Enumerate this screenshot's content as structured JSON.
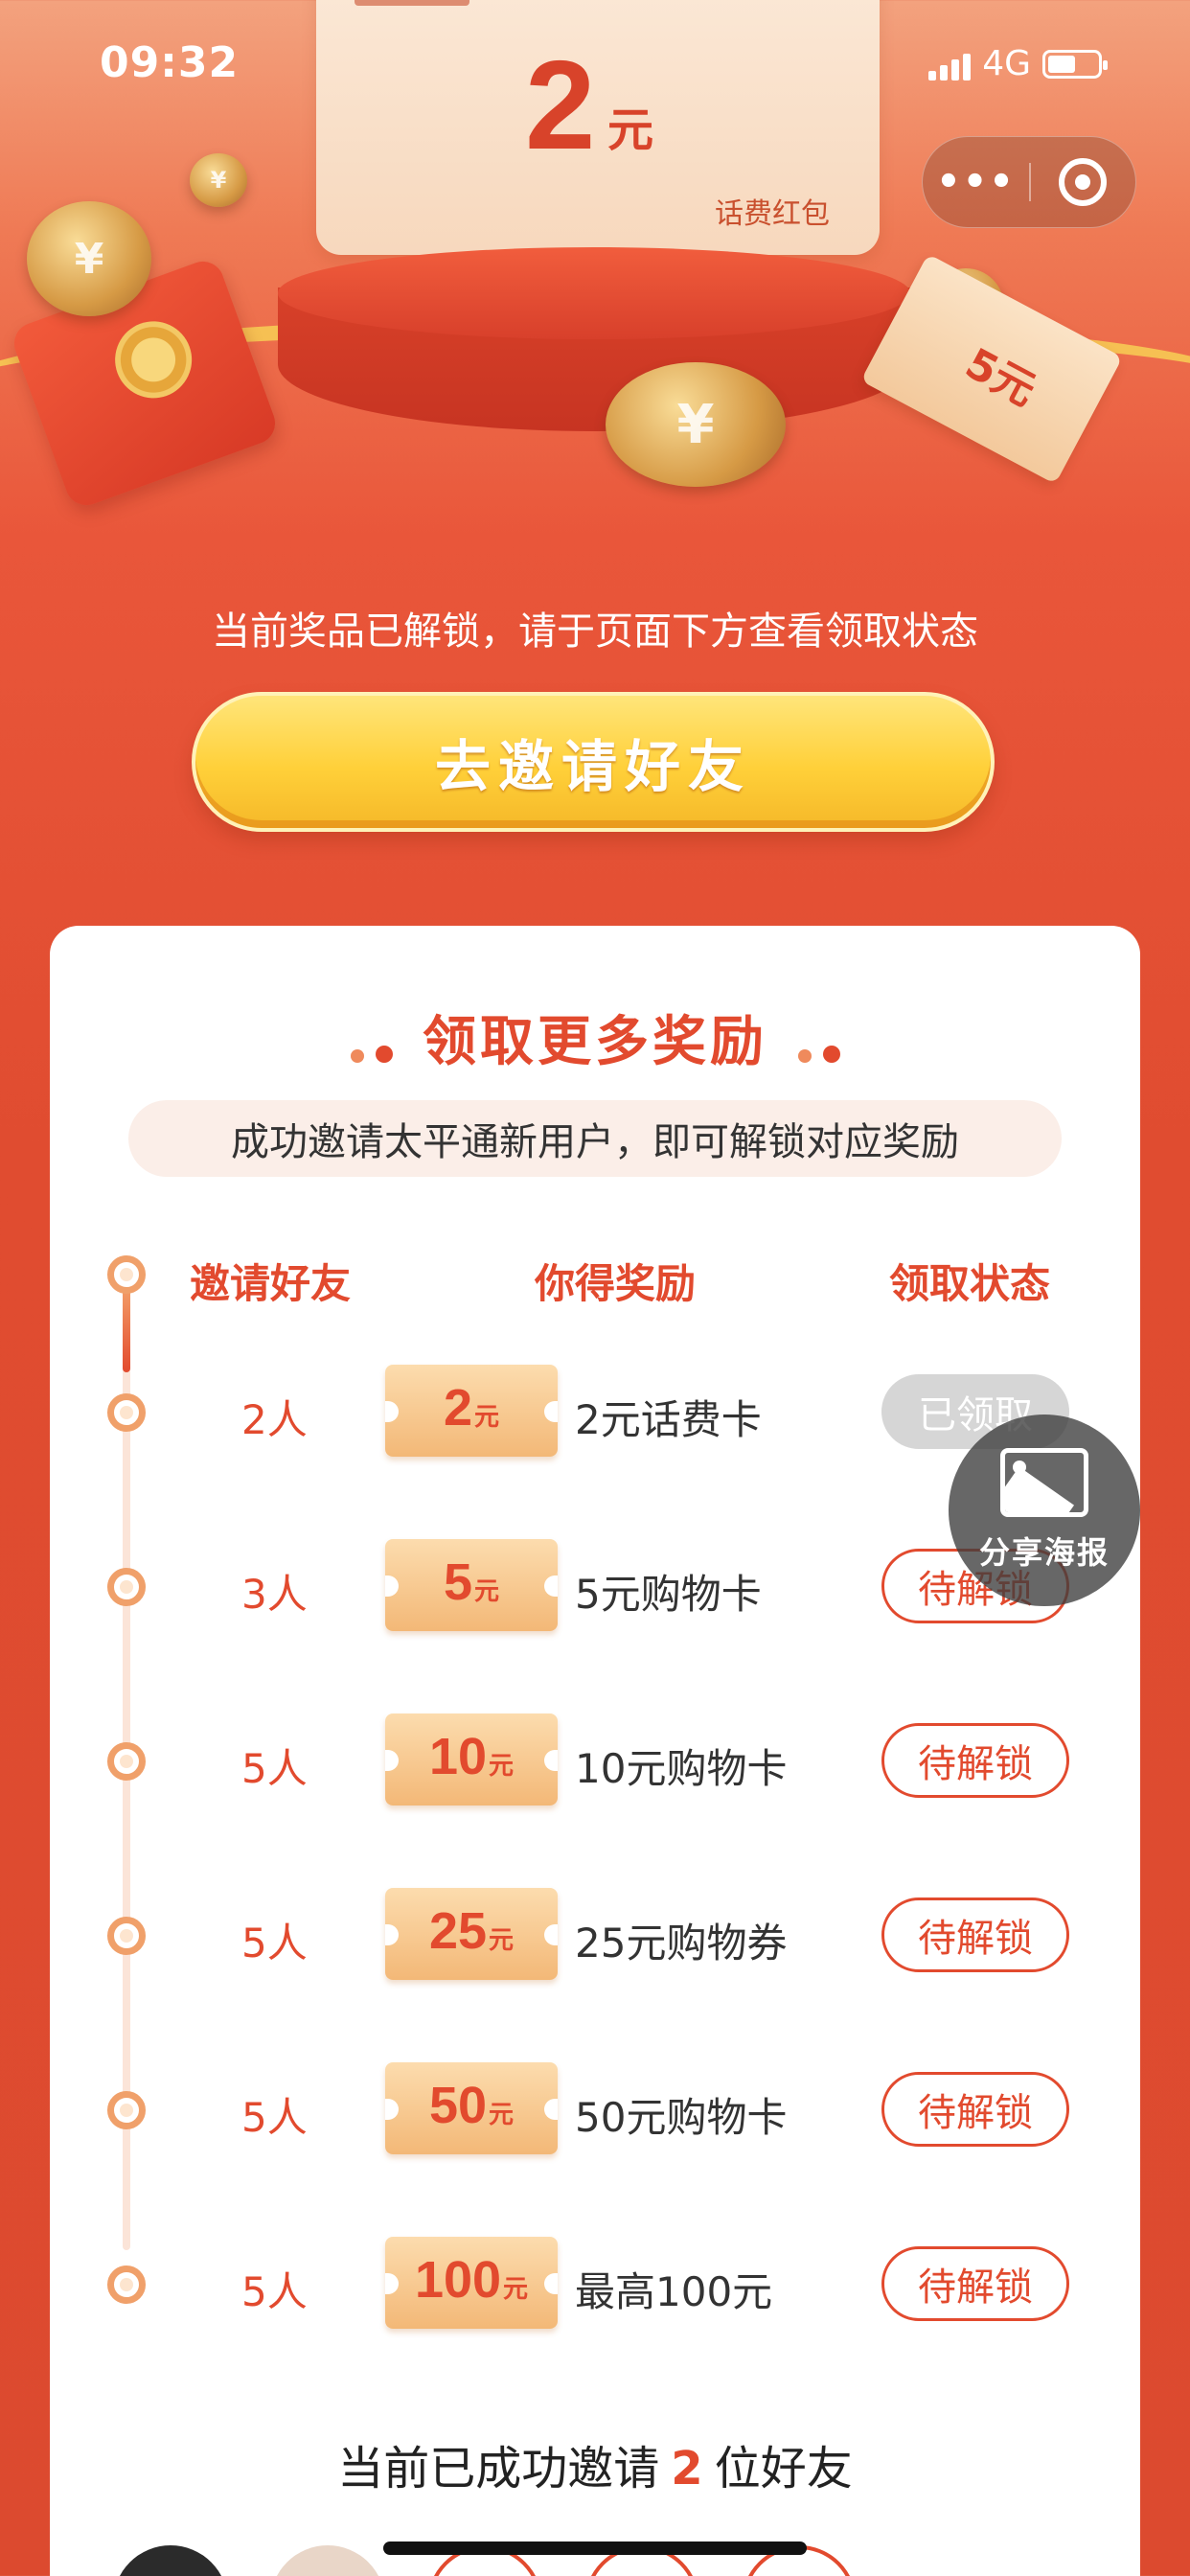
{
  "status_bar": {
    "time": "09:32",
    "network": "4G",
    "battery_level": 0.55
  },
  "capsule": {
    "more_icon": "more-dots-icon",
    "close_icon": "target-icon"
  },
  "hero": {
    "prize_amount": "2",
    "prize_unit": "元",
    "prize_label": "话费红包",
    "ticket_label": "5元",
    "unlock_notice": "当前奖品已解锁，请于页面下方查看领取状态",
    "invite_button": "去邀请好友"
  },
  "rewards": {
    "title": "领取更多奖励",
    "subtitle": "成功邀请太平通新用户，即可解锁对应奖励",
    "columns": {
      "friends": "邀请好友",
      "reward": "你得奖励",
      "status": "领取状态"
    },
    "rows": [
      {
        "people": "2人",
        "amount": "2",
        "unit": "元",
        "name": "2元话费卡",
        "status": "已领取",
        "claimed": true
      },
      {
        "people": "3人",
        "amount": "5",
        "unit": "元",
        "name": "5元购物卡",
        "status": "待解锁",
        "claimed": false
      },
      {
        "people": "5人",
        "amount": "10",
        "unit": "元",
        "name": "10元购物卡",
        "status": "待解锁",
        "claimed": false
      },
      {
        "people": "5人",
        "amount": "25",
        "unit": "元",
        "name": "25元购物券",
        "status": "待解锁",
        "claimed": false
      },
      {
        "people": "5人",
        "amount": "50",
        "unit": "元",
        "name": "50元购物卡",
        "status": "待解锁",
        "claimed": false
      },
      {
        "people": "5人",
        "amount": "100",
        "unit": "元",
        "name": "最高100元",
        "status": "待解锁",
        "claimed": false
      }
    ],
    "summary_prefix": "当前已成功邀请",
    "summary_count": "2",
    "summary_suffix": "位好友"
  },
  "share_poster": {
    "label": "分享海报",
    "icon": "image-icon"
  },
  "colors": {
    "accent": "#e24a2e",
    "gold": "#ffd039",
    "claimed_gray": "#d6d6d6"
  }
}
